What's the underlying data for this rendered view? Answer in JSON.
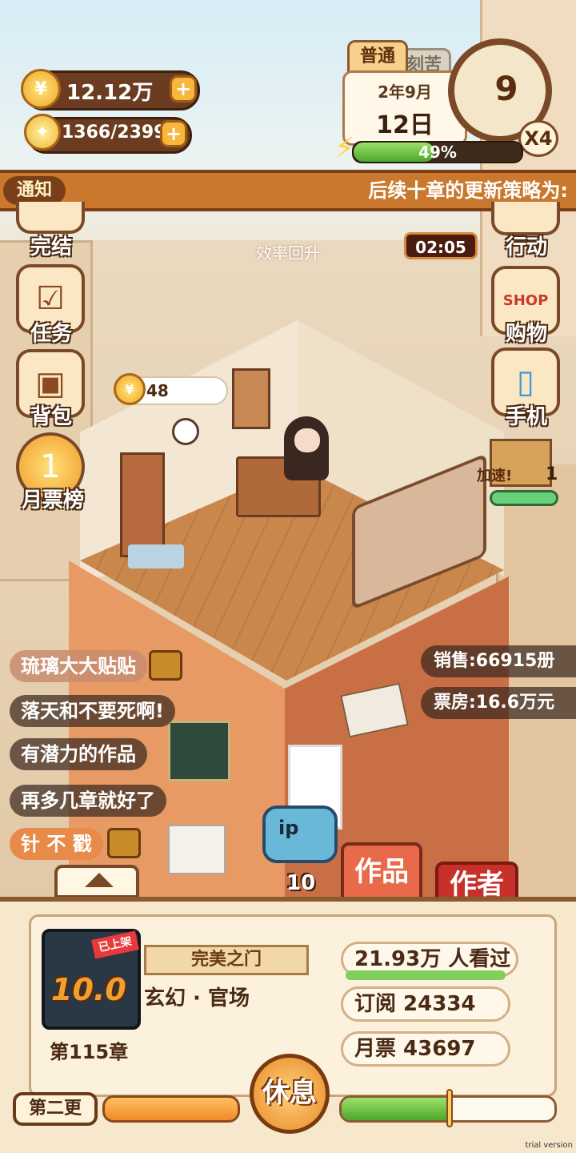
{
  "resources": {
    "coins": "12.12万",
    "energy_bulbs": "1366/2399"
  },
  "calendar": {
    "tab_active": "普通",
    "tab_inactive": "刻苦",
    "month": "2年9月",
    "day": "12日",
    "hour": "9",
    "speed": "X4",
    "energy_percent_text": "49%",
    "energy_level": 0.49
  },
  "notice": {
    "tag": "通知",
    "text": "后续十章的更新策略为:"
  },
  "left_menu": [
    "完结",
    "任务",
    "背包",
    "月票榜"
  ],
  "right_menu": [
    "行动",
    "购物",
    "手机"
  ],
  "timer": "02:05",
  "float_text": "效率回升",
  "coin_bubble": "48",
  "speed_box": {
    "label": "加速!",
    "count": "1"
  },
  "comments": [
    "琉璃大大贴贴",
    "落天和不要死啊!",
    "有潜力的作品",
    "再多几章就好了",
    "针 不 戳"
  ],
  "stats_overlay": {
    "sales": "销售:66915册",
    "box_office": "票房:16.6万元"
  },
  "ip_button": {
    "label": "ip",
    "count": "10"
  },
  "tabs": {
    "works": "作品",
    "author": "作者"
  },
  "book": {
    "title": "完美之门",
    "genre": "玄幻 · 官场",
    "chapter": "第115章",
    "score": "10.0",
    "status_tag": "已上架",
    "views": "21.93万 人看过",
    "subscriptions": "订阅 24334",
    "monthly_tickets": "月票 43697"
  },
  "bottom": {
    "rest_button": "休息",
    "second_update": "第二更",
    "progress_level": 0.5
  },
  "watermark": "trial version"
}
